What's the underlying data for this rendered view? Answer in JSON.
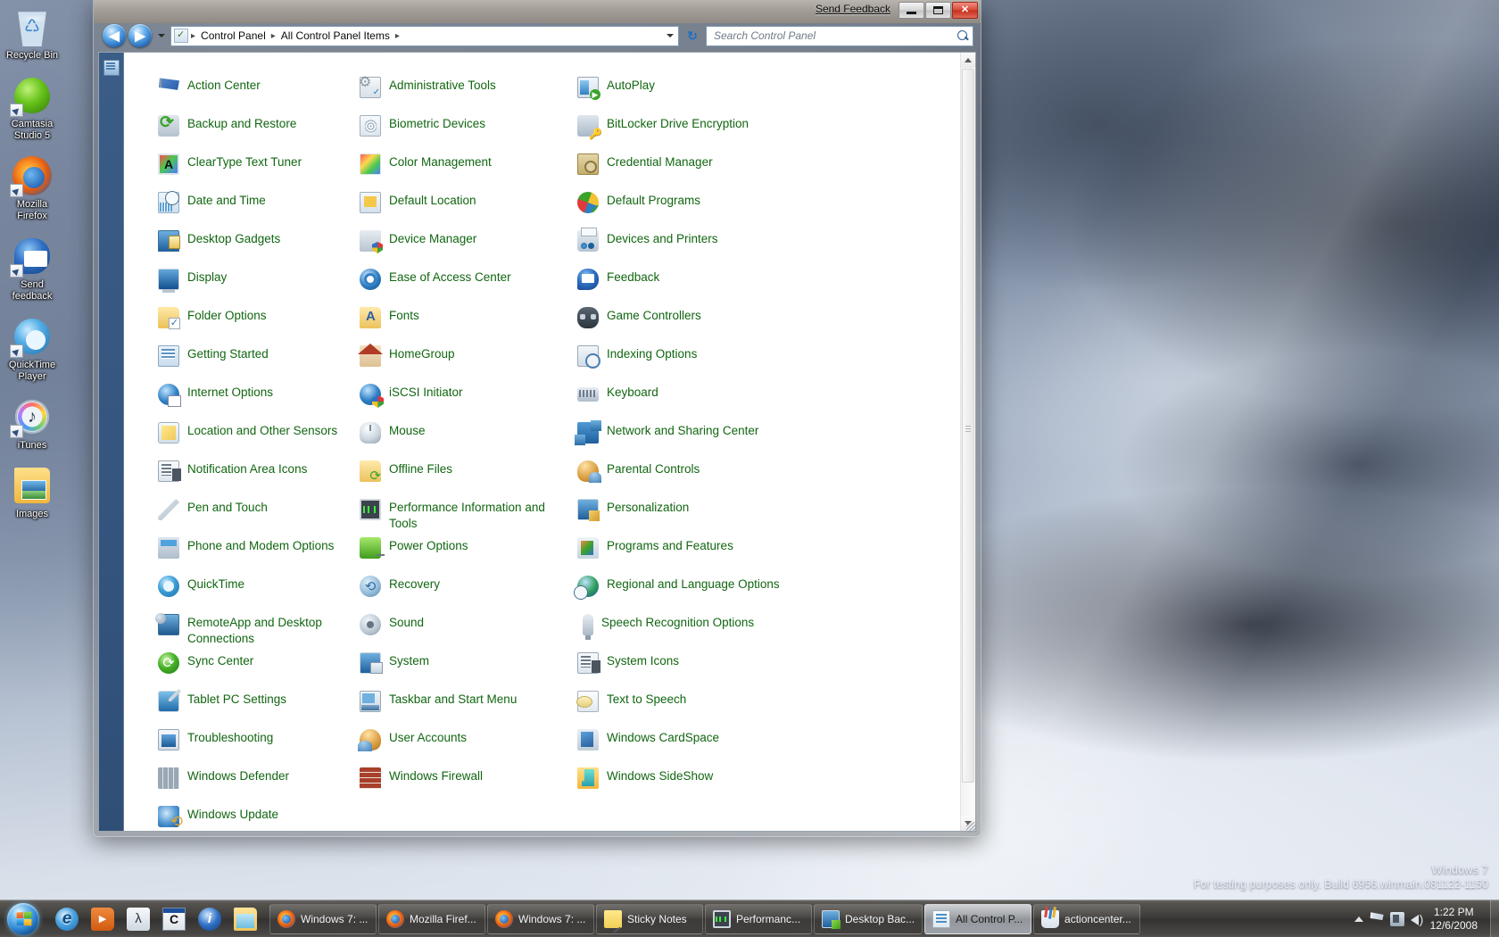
{
  "desktop": {
    "icons": [
      {
        "label": "Recycle Bin",
        "icon": "recycle-bin-icon",
        "shortcut": false
      },
      {
        "label": "Camtasia Studio 5",
        "icon": "camtasia-studio-icon",
        "shortcut": true
      },
      {
        "label": "Mozilla Firefox",
        "icon": "firefox-icon",
        "shortcut": true
      },
      {
        "label": "Send feedback",
        "icon": "send-feedback-icon",
        "shortcut": true
      },
      {
        "label": "QuickTime Player",
        "icon": "quicktime-player-icon",
        "shortcut": true
      },
      {
        "label": "iTunes",
        "icon": "itunes-icon",
        "shortcut": true
      },
      {
        "label": "Images",
        "icon": "images-folder-icon",
        "shortcut": false
      }
    ],
    "watermark": {
      "line1": "Windows 7",
      "line2": "For testing purposes only. Build 6956.winmain.081122-1150"
    }
  },
  "window": {
    "send_feedback": "Send Feedback",
    "buttons": {
      "minimize": "Minimize",
      "maximize": "Maximize",
      "close": "Close",
      "close_glyph": "✕"
    },
    "nav": {
      "back": "◀",
      "forward": "▶",
      "history_dropdown": "Recent pages"
    },
    "address": {
      "crumbs": [
        "Control Panel",
        "All Control Panel Items"
      ],
      "separator": "▸",
      "refresh": "↻"
    },
    "search": {
      "placeholder": "Search Control Panel",
      "value": ""
    }
  },
  "control_panel": {
    "columns": [
      [
        {
          "label": "Action Center",
          "icon": "action-center-icon",
          "cls": "i-flag"
        },
        {
          "label": "Backup and Restore",
          "icon": "backup-and-restore-icon",
          "cls": "i-backup"
        },
        {
          "label": "ClearType Text Tuner",
          "icon": "cleartype-text-tuner-icon",
          "cls": "i-cleartype"
        },
        {
          "label": "Date and Time",
          "icon": "date-and-time-icon",
          "cls": "i-datetime"
        },
        {
          "label": "Desktop Gadgets",
          "icon": "desktop-gadgets-icon",
          "cls": "i-gadgets"
        },
        {
          "label": "Display",
          "icon": "display-icon",
          "cls": "i-display"
        },
        {
          "label": "Folder Options",
          "icon": "folder-options-icon",
          "cls": "i-folderopt"
        },
        {
          "label": "Getting Started",
          "icon": "getting-started-icon",
          "cls": "i-getstart"
        },
        {
          "label": "Internet Options",
          "icon": "internet-options-icon",
          "cls": "i-internet"
        },
        {
          "label": "Location and Other Sensors",
          "icon": "location-and-other-sensors-icon",
          "cls": "i-location"
        },
        {
          "label": "Notification Area Icons",
          "icon": "notification-area-icons-icon",
          "cls": "i-notify"
        },
        {
          "label": "Pen and Touch",
          "icon": "pen-and-touch-icon",
          "cls": "i-pen"
        },
        {
          "label": "Phone and Modem Options",
          "icon": "phone-and-modem-options-icon",
          "cls": "i-phone"
        },
        {
          "label": "QuickTime",
          "icon": "quicktime-icon",
          "cls": "i-qt"
        },
        {
          "label": "RemoteApp and Desktop Connections",
          "icon": "remoteapp-and-desktop-connections-icon",
          "cls": "i-remoteapp"
        },
        {
          "label": "Sync Center",
          "icon": "sync-center-icon",
          "cls": "i-sync"
        },
        {
          "label": "Tablet PC Settings",
          "icon": "tablet-pc-settings-icon",
          "cls": "i-tablet"
        },
        {
          "label": "Troubleshooting",
          "icon": "troubleshooting-icon",
          "cls": "i-trouble"
        },
        {
          "label": "Windows Defender",
          "icon": "windows-defender-icon",
          "cls": "i-defender"
        },
        {
          "label": "Windows Update",
          "icon": "windows-update-icon",
          "cls": "i-update"
        }
      ],
      [
        {
          "label": "Administrative Tools",
          "icon": "administrative-tools-icon",
          "cls": "i-admintools"
        },
        {
          "label": "Biometric Devices",
          "icon": "biometric-devices-icon",
          "cls": "i-biometric"
        },
        {
          "label": "Color Management",
          "icon": "color-management-icon",
          "cls": "i-color"
        },
        {
          "label": "Default Location",
          "icon": "default-location-icon",
          "cls": "i-defloc"
        },
        {
          "label": "Device Manager",
          "icon": "device-manager-icon",
          "cls": "i-devmgr"
        },
        {
          "label": "Ease of Access Center",
          "icon": "ease-of-access-center-icon",
          "cls": "i-ease"
        },
        {
          "label": "Fonts",
          "icon": "fonts-icon",
          "cls": "i-fonts"
        },
        {
          "label": "HomeGroup",
          "icon": "homegroup-icon",
          "cls": "i-homegroup"
        },
        {
          "label": "iSCSI Initiator",
          "icon": "iscsi-initiator-icon",
          "cls": "i-iscsi"
        },
        {
          "label": "Mouse",
          "icon": "mouse-icon",
          "cls": "i-mouse"
        },
        {
          "label": "Offline Files",
          "icon": "offline-files-icon",
          "cls": "i-offline"
        },
        {
          "label": "Performance Information and Tools",
          "icon": "performance-information-and-tools-icon",
          "cls": "i-perf"
        },
        {
          "label": "Power Options",
          "icon": "power-options-icon",
          "cls": "i-power"
        },
        {
          "label": "Recovery",
          "icon": "recovery-icon",
          "cls": "i-recovery"
        },
        {
          "label": "Sound",
          "icon": "sound-icon",
          "cls": "i-sound"
        },
        {
          "label": "System",
          "icon": "system-icon",
          "cls": "i-system"
        },
        {
          "label": "Taskbar and Start Menu",
          "icon": "taskbar-and-start-menu-icon",
          "cls": "i-taskbar"
        },
        {
          "label": "User Accounts",
          "icon": "user-accounts-icon",
          "cls": "i-useracct"
        },
        {
          "label": "Windows Firewall",
          "icon": "windows-firewall-icon",
          "cls": "i-firewall"
        }
      ],
      [
        {
          "label": "AutoPlay",
          "icon": "autoplay-icon",
          "cls": "i-autoplay"
        },
        {
          "label": "BitLocker Drive Encryption",
          "icon": "bitlocker-drive-encryption-icon",
          "cls": "i-bitlocker"
        },
        {
          "label": "Credential Manager",
          "icon": "credential-manager-icon",
          "cls": "i-credential"
        },
        {
          "label": "Default Programs",
          "icon": "default-programs-icon",
          "cls": "i-defprog"
        },
        {
          "label": "Devices and Printers",
          "icon": "devices-and-printers-icon",
          "cls": "i-devprint"
        },
        {
          "label": "Feedback",
          "icon": "feedback-icon",
          "cls": "i-fb"
        },
        {
          "label": "Game Controllers",
          "icon": "game-controllers-icon",
          "cls": "i-gamectrl"
        },
        {
          "label": "Indexing Options",
          "icon": "indexing-options-icon",
          "cls": "i-indexing"
        },
        {
          "label": "Keyboard",
          "icon": "keyboard-icon",
          "cls": "i-keyboard"
        },
        {
          "label": "Network and Sharing Center",
          "icon": "network-and-sharing-center-icon",
          "cls": "i-network"
        },
        {
          "label": "Parental Controls",
          "icon": "parental-controls-icon",
          "cls": "i-parental"
        },
        {
          "label": "Personalization",
          "icon": "personalization-icon",
          "cls": "i-personalization"
        },
        {
          "label": "Programs and Features",
          "icon": "programs-and-features-icon",
          "cls": "i-progfeat"
        },
        {
          "label": "Regional and Language Options",
          "icon": "regional-and-language-options-icon",
          "cls": "i-regional"
        },
        {
          "label": "Speech Recognition Options",
          "icon": "speech-recognition-options-icon",
          "cls": "i-speechrec"
        },
        {
          "label": "System Icons",
          "icon": "system-icons-icon",
          "cls": "i-sysicons"
        },
        {
          "label": "Text to Speech",
          "icon": "text-to-speech-icon",
          "cls": "i-text2speech"
        },
        {
          "label": "Windows CardSpace",
          "icon": "windows-cardspace-icon",
          "cls": "i-cardspace"
        },
        {
          "label": "Windows SideShow",
          "icon": "windows-sideshow-icon",
          "cls": "i-sideshow"
        }
      ]
    ],
    "link_color": "#116611"
  },
  "taskbar": {
    "start": {
      "label": "Start",
      "icon": "windows-start-orb-icon"
    },
    "quick_launch": [
      {
        "label": "Internet Explorer",
        "icon": "internet-explorer-icon",
        "cls": "q-ie"
      },
      {
        "label": "Windows Media Player",
        "icon": "windows-media-player-icon",
        "cls": "q-wmp"
      },
      {
        "label": "Lambda App",
        "icon": "lambda-app-icon",
        "cls": "q-lambda"
      },
      {
        "label": "Camtasia Recorder",
        "icon": "camtasia-recorder-icon",
        "cls": "q-camtasia"
      },
      {
        "label": "Info Tool",
        "icon": "info-tool-icon",
        "cls": "q-info"
      },
      {
        "label": "Windows Explorer",
        "icon": "windows-explorer-icon",
        "cls": "q-explorer"
      }
    ],
    "windows": [
      {
        "label": "Windows 7: ...",
        "icon": "firefox-taskbar-icon",
        "cls": "t-ff",
        "active": false
      },
      {
        "label": "Mozilla Firef...",
        "icon": "firefox-taskbar-icon",
        "cls": "t-ff",
        "active": false
      },
      {
        "label": "Windows 7: ...",
        "icon": "firefox-taskbar-icon",
        "cls": "t-ff",
        "active": false
      },
      {
        "label": "Sticky Notes",
        "icon": "sticky-notes-icon",
        "cls": "t-sticky",
        "active": false
      },
      {
        "label": "Performanc...",
        "icon": "performance-monitor-icon",
        "cls": "t-perf",
        "active": false
      },
      {
        "label": "Desktop Bac...",
        "icon": "desktop-background-icon",
        "cls": "t-deskbg",
        "active": false
      },
      {
        "label": "All Control P...",
        "icon": "control-panel-icon",
        "cls": "t-cpanel",
        "active": true
      },
      {
        "label": "actioncenter...",
        "icon": "notes-app-icon",
        "cls": "t-notes",
        "active": false
      }
    ],
    "tray": {
      "expand": "Show hidden icons",
      "icons": [
        {
          "name": "action-center-flag-icon",
          "cls": "ty-flag"
        },
        {
          "name": "network-icon",
          "cls": "ty-net"
        },
        {
          "name": "volume-icon",
          "cls": "ty-vol"
        }
      ],
      "time": "1:22 PM",
      "date": "12/6/2008",
      "show_desktop": "Show desktop"
    }
  }
}
